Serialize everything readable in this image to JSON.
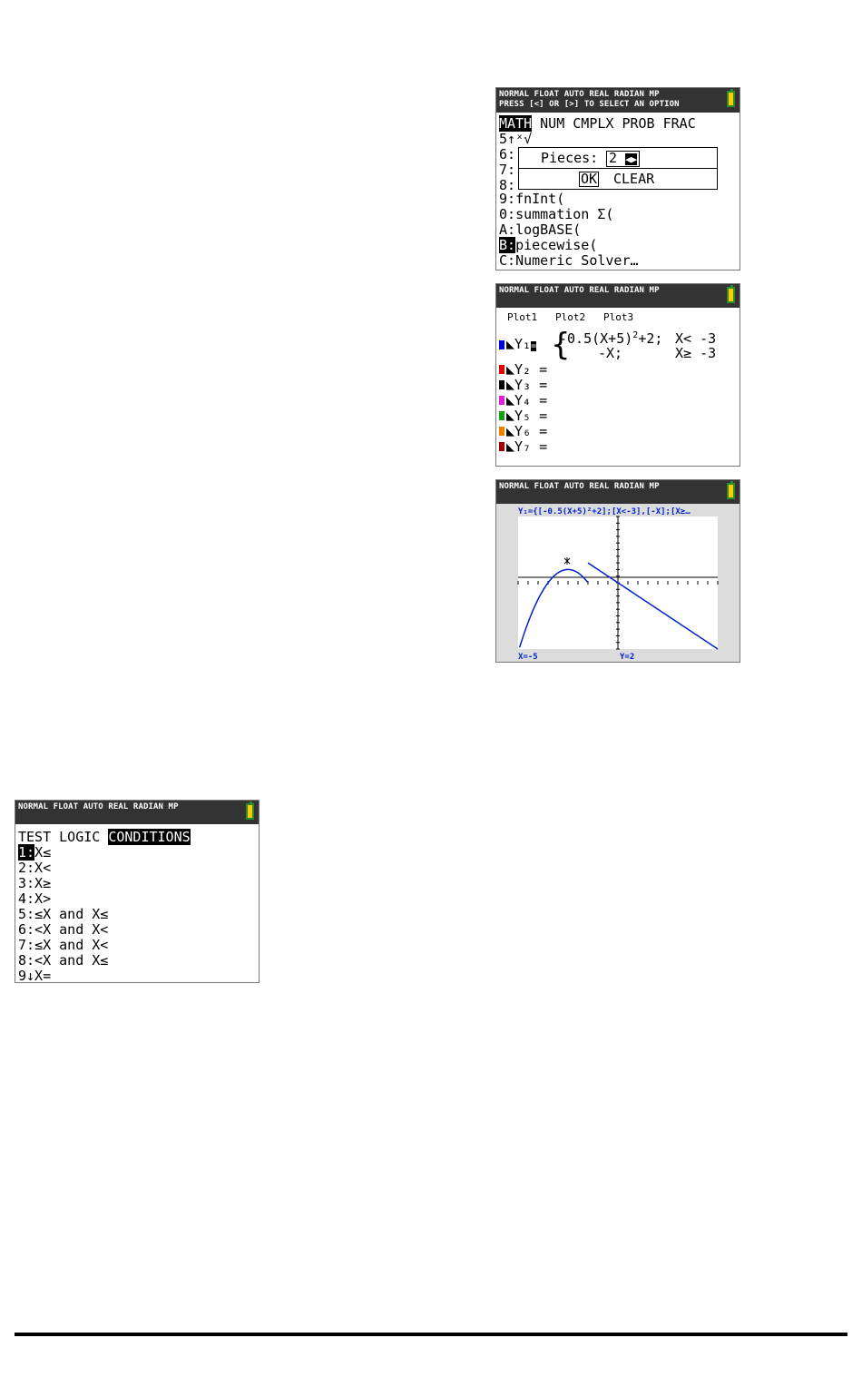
{
  "status": {
    "mode_line": "NORMAL FLOAT AUTO REAL RADIAN MP",
    "press_line": "PRESS [<] OR [>] TO SELECT AN OPTION"
  },
  "math_menu": {
    "tabs": [
      "MATH",
      "NUM",
      "CMPLX",
      "PROB",
      "FRAC"
    ],
    "items": [
      {
        "key": "5↑",
        "label": "ˣ√"
      },
      {
        "key": "6:",
        "label": ""
      },
      {
        "key": "7:",
        "label": ""
      },
      {
        "key": "8:",
        "label": ""
      },
      {
        "key": "9:",
        "label": "fnInt("
      },
      {
        "key": "0:",
        "label": "summation Σ("
      },
      {
        "key": "A:",
        "label": "logBASE("
      },
      {
        "key": "B:",
        "label": "piecewise("
      },
      {
        "key": "C:",
        "label": "Numeric Solver…"
      }
    ],
    "dialog": {
      "pieces_label": "Pieces:",
      "pieces_value": "2",
      "ok": "OK",
      "clear": "CLEAR"
    }
  },
  "y_editor": {
    "plots": [
      "Plot1",
      "Plot2",
      "Plot3"
    ],
    "y1": {
      "name": "Y₁",
      "piece1_expr_a": "-0.5(X+5)",
      "piece1_exp": "2",
      "piece1_expr_b": "+2;",
      "piece1_cond": "X< -3",
      "piece2_expr": "-X;",
      "piece2_cond": "X≥ -3"
    },
    "others": [
      {
        "name": "Y₂ =",
        "color": "#e00000"
      },
      {
        "name": "Y₃ =",
        "color": "#000000"
      },
      {
        "name": "Y₄ =",
        "color": "#e020e0"
      },
      {
        "name": "Y₅ =",
        "color": "#10a010"
      },
      {
        "name": "Y₆ =",
        "color": "#f08000"
      },
      {
        "name": "Y₇ =",
        "color": "#a00000"
      }
    ],
    "y1_color": "#0000e0"
  },
  "graph": {
    "header": "Y₁={[-0.5(X+5)²+2];[X<-3],[-X];[X≥…",
    "x_readout": "X=-5",
    "y_readout": "Y=2",
    "curve_color": "#0022cc"
  },
  "test_menu": {
    "tabs": [
      "TEST",
      "LOGIC",
      "CONDITIONS"
    ],
    "items": [
      "1:X≤",
      "2:X<",
      "3:X≥",
      "4:X>",
      "5:≤X and X≤",
      "6:<X and X<",
      "7:≤X and X<",
      "8:<X and X≤",
      "9↓X="
    ]
  }
}
